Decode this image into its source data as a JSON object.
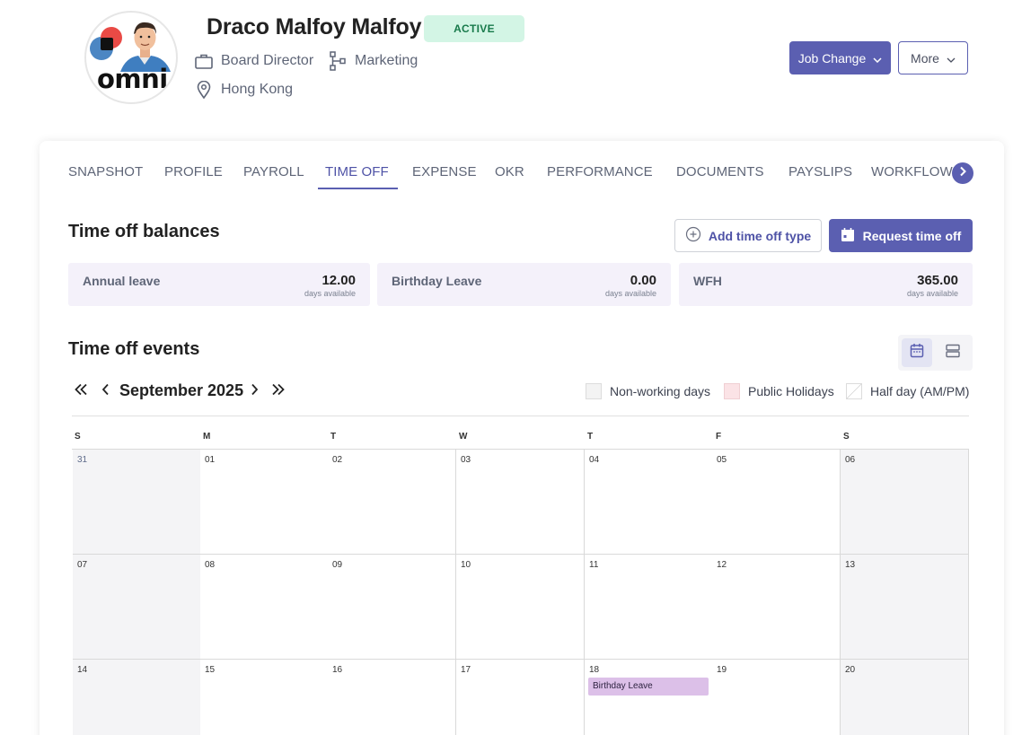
{
  "employee": {
    "name": "Draco Malfoy Malfoy",
    "status": "ACTIVE",
    "job_title": "Board Director",
    "department": "Marketing",
    "location": "Hong Kong",
    "avatar_logo_text": "omni"
  },
  "header_actions": {
    "job_change_label": "Job Change",
    "more_label": "More"
  },
  "tabs": [
    {
      "label": "SNAPSHOT"
    },
    {
      "label": "PROFILE"
    },
    {
      "label": "PAYROLL"
    },
    {
      "label": "TIME OFF",
      "active": true
    },
    {
      "label": "EXPENSE"
    },
    {
      "label": "OKR"
    },
    {
      "label": "PERFORMANCE"
    },
    {
      "label": "DOCUMENTS"
    },
    {
      "label": "PAYSLIPS"
    },
    {
      "label": "WORKFLOW"
    }
  ],
  "balances_section": {
    "title": "Time off balances",
    "add_type_label": "Add time off type",
    "request_label": "Request time off",
    "items": [
      {
        "name": "Annual leave",
        "value": "12.00",
        "unit": "days available"
      },
      {
        "name": "Birthday Leave",
        "value": "0.00",
        "unit": "days available"
      },
      {
        "name": "WFH",
        "value": "365.00",
        "unit": "days available"
      }
    ]
  },
  "events_section": {
    "title": "Time off events",
    "month_label": "September 2025",
    "legend": [
      {
        "label": "Non-working days",
        "color": "#f3f3f3"
      },
      {
        "label": "Public Holidays",
        "color": "#fbe3e6"
      },
      {
        "label": "Half day (AM/PM)",
        "color": "#ffffff"
      }
    ],
    "weekdays": [
      "S",
      "M",
      "T",
      "W",
      "T",
      "F",
      "S"
    ],
    "weeks": [
      [
        "31",
        "01",
        "02",
        "03",
        "04",
        "05",
        "06"
      ],
      [
        "07",
        "08",
        "09",
        "10",
        "11",
        "12",
        "13"
      ],
      [
        "14",
        "15",
        "16",
        "17",
        "18",
        "19",
        "20"
      ]
    ],
    "events": [
      {
        "label": "Birthday Leave",
        "week": 2,
        "day": 4,
        "color": "#dcc0e8"
      }
    ]
  },
  "colors": {
    "accent": "#5b5fb1",
    "active_badge_bg": "#d3f5e5",
    "active_badge_text": "#187a4b",
    "balance_card_bg": "#f4f1fa",
    "weekend_bg": "#f4f4f6"
  },
  "icons": {
    "job_title": "briefcase-icon",
    "department": "org-chart-icon",
    "location": "map-pin-icon",
    "add_type": "plus-circle-icon",
    "request": "calendar-icon",
    "tabs_next": "chevron-right-icon",
    "view_calendar": "calendar-icon",
    "view_list": "list-icon"
  }
}
